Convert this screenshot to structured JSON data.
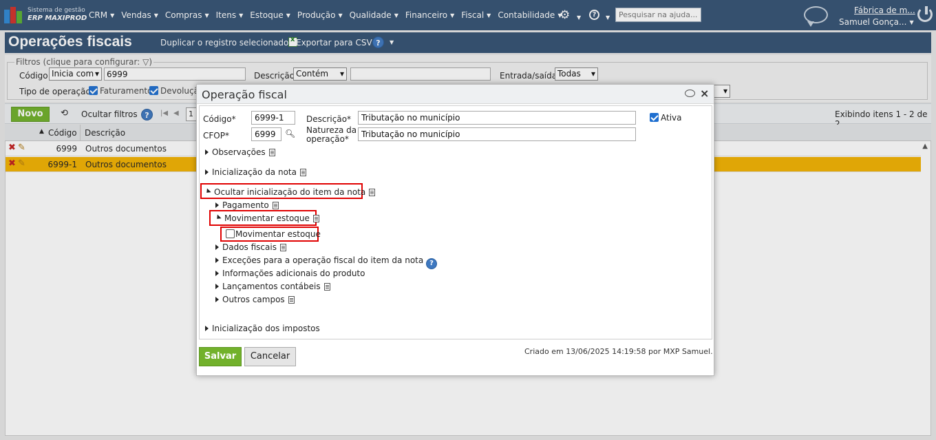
{
  "nav": {
    "logo_line1": "Sistema de gestão",
    "logo_line2": "ERP MAXIPROD",
    "menu": [
      "CRM",
      "Vendas",
      "Compras",
      "Itens",
      "Estoque",
      "Produção",
      "Qualidade",
      "Financeiro",
      "Fiscal",
      "Contabilidade"
    ],
    "help_search_placeholder": "Pesquisar na ajuda...",
    "company": "Fábrica de m...",
    "user": "Samuel Gonça..."
  },
  "page": {
    "title": "Operações fiscais",
    "duplicate_link": "Duplicar o registro selecionado",
    "export_link": "Exportar para CSV"
  },
  "filters": {
    "legend": "Filtros (clique para configurar:",
    "codigo_label": "Código",
    "codigo_mode": "Inicia com",
    "codigo_value": "6999",
    "descricao_label": "Descrição",
    "descricao_mode": "Contém",
    "descricao_value": "",
    "entrada_label": "Entrada/saída",
    "entrada_value": "Todas",
    "tipo_label": "Tipo de operação",
    "tipo_faturamento": "Faturamento",
    "tipo_devolucao": "Devoluçã"
  },
  "toolbar": {
    "novo": "Novo",
    "ocultar_filtros": "Ocultar filtros",
    "page_num": "1",
    "exibindo": "Exibindo itens 1 - 2 de 2"
  },
  "grid": {
    "columns": [
      "Código",
      "Descrição"
    ],
    "rows": [
      {
        "code": "6999",
        "desc": "Outros documentos"
      },
      {
        "code": "6999-1",
        "desc": "Outros documentos"
      }
    ]
  },
  "modal": {
    "title": "Operação fiscal",
    "codigo_label": "Código*",
    "codigo_value": "6999-1",
    "descricao_label": "Descrição*",
    "descricao_value": "Tributação no município",
    "ativa_label": "Ativa",
    "cfop_label": "CFOP*",
    "cfop_value": "6999",
    "natureza_label_1": "Natureza da",
    "natureza_label_2": "operação*",
    "natureza_value": "Tributação no município",
    "sections": {
      "observacoes": "Observações",
      "inicializacao_nota": "Inicialização da nota",
      "ocultar_item": "Ocultar inicialização do item da nota",
      "pagamento": "Pagamento",
      "movimentar_estoque": "Movimentar estoque",
      "movimentar_checkbox": "Movimentar estoque",
      "dados_fiscais": "Dados fiscais",
      "excecoes": "Exceções para a operação fiscal do item da nota",
      "info_adicionais": "Informações adicionais do produto",
      "lancamentos": "Lançamentos contábeis",
      "outros_campos": "Outros campos",
      "inicializacao_impostos": "Inicialização dos impostos"
    },
    "salvar": "Salvar",
    "cancelar": "Cancelar",
    "created": "Criado em 13/06/2025 14:19:58 por MXP Samuel."
  },
  "colors": {
    "nav_bg": "#355374",
    "accent_green": "#72b12b",
    "selected_row": "#f3b300",
    "highlight_red": "#e00000"
  }
}
